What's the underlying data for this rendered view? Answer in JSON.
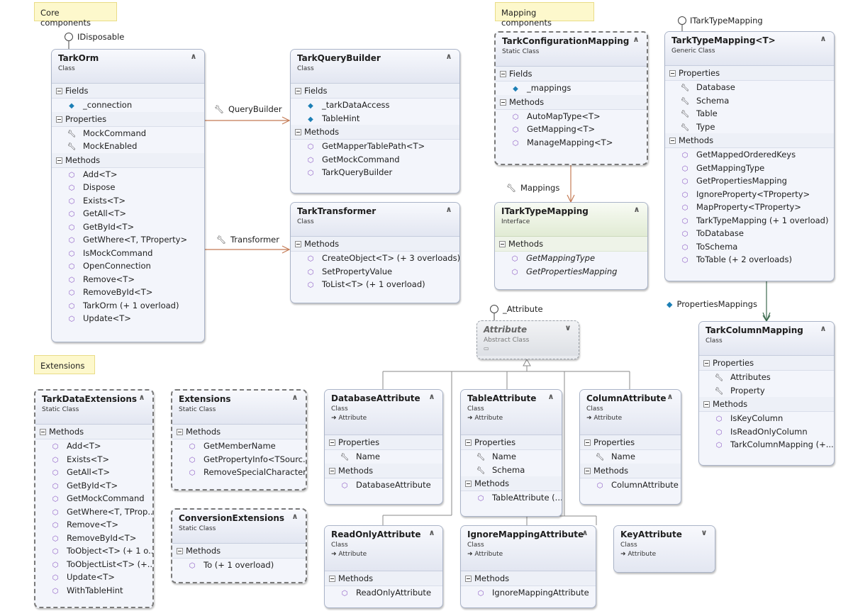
{
  "comments": {
    "core": "Core components",
    "mapping": "Mapping components",
    "extensions": "Extensions"
  },
  "icons": {
    "method": "method-icon",
    "field": "field-icon",
    "property": "property-icon",
    "extension_method": "extension-method-icon",
    "collapse": "chevron-up-icon",
    "expand": "chevron-down-icon"
  },
  "colors": {
    "class_header": "#e2e6f1",
    "interface_header": "#e1ebd4",
    "comment": "#fdf8cc",
    "association": "#c47b55",
    "dark_association": "#3d6b4f"
  },
  "lollipops": {
    "idisposable": "IDisposable",
    "itarktypemapping": "ITarkTypeMapping",
    "attribute": "_Attribute"
  },
  "associations": {
    "querybuilder": "QueryBuilder",
    "transformer": "Transformer",
    "mappings": "Mappings",
    "propertiesmappings": "PropertiesMappings"
  },
  "classes": {
    "tarkorm": {
      "name": "TarkOrm",
      "stereotype": "Class",
      "fields_label": "Fields",
      "fields": [
        "_connection"
      ],
      "properties_label": "Properties",
      "properties": [
        "MockCommand",
        "MockEnabled"
      ],
      "methods_label": "Methods",
      "methods": [
        "Add<T>",
        "Dispose",
        "Exists<T>",
        "GetAll<T>",
        "GetById<T>",
        "GetWhere<T, TProperty>",
        "IsMockCommand",
        "OpenConnection",
        "Remove<T>",
        "RemoveById<T>",
        "TarkOrm (+ 1 overload)",
        "Update<T>"
      ]
    },
    "tarkquerybuilder": {
      "name": "TarkQueryBuilder",
      "stereotype": "Class",
      "fields_label": "Fields",
      "fields": [
        "_tarkDataAccess",
        "TableHint"
      ],
      "methods_label": "Methods",
      "methods": [
        "GetMapperTablePath<T>",
        "GetMockCommand",
        "TarkQueryBuilder"
      ]
    },
    "tarktransformer": {
      "name": "TarkTransformer",
      "stereotype": "Class",
      "methods_label": "Methods",
      "methods": [
        "CreateObject<T> (+ 3 overloads)",
        "SetPropertyValue",
        "ToList<T> (+ 1 overload)"
      ]
    },
    "tarkconfigurationmapping": {
      "name": "TarkConfigurationMapping",
      "stereotype": "Static Class",
      "fields_label": "Fields",
      "fields": [
        "_mappings"
      ],
      "methods_label": "Methods",
      "methods": [
        "AutoMapType<T>",
        "GetMapping<T>",
        "ManageMapping<T>"
      ]
    },
    "itarktypemapping": {
      "name": "ITarkTypeMapping",
      "stereotype": "Interface",
      "methods_label": "Methods",
      "methods": [
        "GetMappingType",
        "GetPropertiesMapping"
      ]
    },
    "tarktypemapping": {
      "name": "TarkTypeMapping<T>",
      "stereotype": "Generic Class",
      "properties_label": "Properties",
      "properties": [
        "Database",
        "Schema",
        "Table",
        "Type"
      ],
      "methods_label": "Methods",
      "methods": [
        "GetMappedOrderedKeys",
        "GetMappingType",
        "GetPropertiesMapping",
        "IgnoreProperty<TProperty>",
        "MapProperty<TProperty>",
        "TarkTypeMapping (+ 1 overload)",
        "ToDatabase",
        "ToSchema",
        "ToTable (+ 2 overloads)"
      ]
    },
    "tarkcolumnmapping": {
      "name": "TarkColumnMapping",
      "stereotype": "Class",
      "properties_label": "Properties",
      "properties": [
        "Attributes",
        "Property"
      ],
      "methods_label": "Methods",
      "methods": [
        "IsKeyColumn",
        "IsReadOnlyColumn",
        "TarkColumnMapping (+..."
      ]
    },
    "attribute": {
      "name": "Attribute",
      "stereotype": "Abstract Class"
    },
    "databaseattribute": {
      "name": "DatabaseAttribute",
      "stereotype": "Class",
      "base": "Attribute",
      "properties_label": "Properties",
      "properties": [
        "Name"
      ],
      "methods_label": "Methods",
      "methods": [
        "DatabaseAttribute"
      ]
    },
    "tableattribute": {
      "name": "TableAttribute",
      "stereotype": "Class",
      "base": "Attribute",
      "properties_label": "Properties",
      "properties": [
        "Name",
        "Schema"
      ],
      "methods_label": "Methods",
      "methods": [
        "TableAttribute (..."
      ]
    },
    "columnattribute": {
      "name": "ColumnAttribute",
      "stereotype": "Class",
      "base": "Attribute",
      "properties_label": "Properties",
      "properties": [
        "Name"
      ],
      "methods_label": "Methods",
      "methods": [
        "ColumnAttribute"
      ]
    },
    "readonlyattribute": {
      "name": "ReadOnlyAttribute",
      "stereotype": "Class",
      "base": "Attribute",
      "methods_label": "Methods",
      "methods": [
        "ReadOnlyAttribute"
      ]
    },
    "ignoremappingattribute": {
      "name": "IgnoreMappingAttribute",
      "stereotype": "Class",
      "base": "Attribute",
      "methods_label": "Methods",
      "methods": [
        "IgnoreMappingAttribute"
      ]
    },
    "keyattribute": {
      "name": "KeyAttribute",
      "stereotype": "Class",
      "base": "Attribute"
    },
    "tarkdataextensions": {
      "name": "TarkDataExtensions",
      "stereotype": "Static Class",
      "methods_label": "Methods",
      "methods": [
        "Add<T>",
        "Exists<T>",
        "GetAll<T>",
        "GetById<T>",
        "GetMockCommand",
        "GetWhere<T,  TProp...",
        "Remove<T>",
        "RemoveById<T>",
        "ToObject<T> (+ 1 o...",
        "ToObjectList<T> (+...",
        "Update<T>",
        "WithTableHint"
      ]
    },
    "extensions": {
      "name": "Extensions",
      "stereotype": "Static Class",
      "methods_label": "Methods",
      "methods": [
        "GetMemberName",
        "GetPropertyInfo<TSourc...",
        "RemoveSpecialCharacters"
      ]
    },
    "conversionextensions": {
      "name": "ConversionExtensions",
      "stereotype": "Static Class",
      "methods_label": "Methods",
      "methods": [
        "To (+ 1 overload)"
      ]
    }
  }
}
